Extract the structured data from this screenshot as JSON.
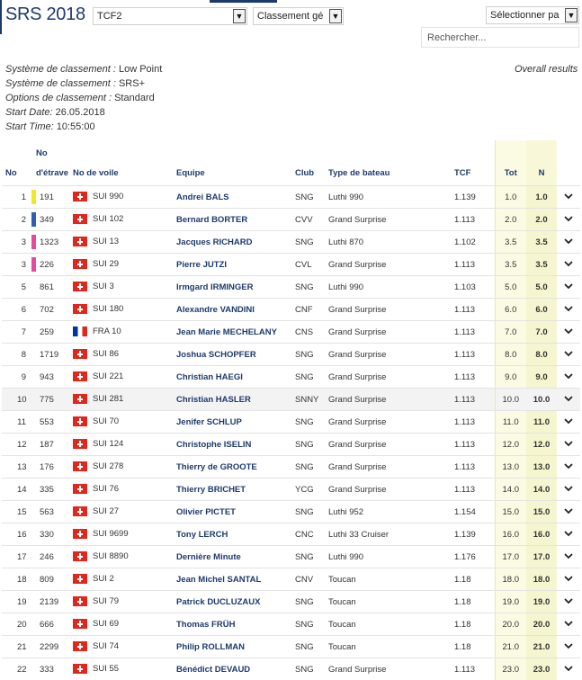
{
  "header": {
    "title": "SRS 2018",
    "race_select": "TCF2",
    "ranking_select": "Classement gé",
    "choose_select": "Sélectionner pa",
    "search_placeholder": "Rechercher...",
    "overall_link": "Overall results"
  },
  "info": [
    {
      "key": "Système de classement :",
      "value": "Low Point"
    },
    {
      "key": "Système de classement :",
      "value": "SRS+"
    },
    {
      "key": "Options de classement :",
      "value": "Standard"
    },
    {
      "key": "Start Date:",
      "value": "26.05.2018"
    },
    {
      "key": "Start Time:",
      "value": "10:55:00"
    }
  ],
  "columns": {
    "no": "No",
    "bow_top": "No",
    "bow_bottom": "d'étrave",
    "sail": "No de voile",
    "crew": "Equipe",
    "club": "Club",
    "boat": "Type de bateau",
    "tcf": "TCF",
    "tot": "Tot",
    "n": "N"
  },
  "colors": {
    "accent": "#1d3a6e",
    "yellow": "#f2e82a",
    "blue": "#2f5fb5",
    "pink": "#e84a9b"
  },
  "rows": [
    {
      "no": "1",
      "marker": "yellow",
      "bow": "191",
      "flag": "sui",
      "sail": "SUI 990",
      "crew": "Andrei BALS",
      "club": "SNG",
      "boat": "Luthi 990",
      "tcf": "1.139",
      "tot": "1.0",
      "n": "1.0"
    },
    {
      "no": "2",
      "marker": "blue",
      "bow": "349",
      "flag": "sui",
      "sail": "SUI 102",
      "crew": "Bernard BORTER",
      "club": "CVV",
      "boat": "Grand Surprise",
      "tcf": "1.113",
      "tot": "2.0",
      "n": "2.0"
    },
    {
      "no": "3",
      "marker": "pink",
      "bow": "1323",
      "flag": "sui",
      "sail": "SUI 13",
      "crew": "Jacques RICHARD",
      "club": "SNG",
      "boat": "Luthi 870",
      "tcf": "1.102",
      "tot": "3.5",
      "n": "3.5"
    },
    {
      "no": "3",
      "marker": "pink",
      "bow": "226",
      "flag": "sui",
      "sail": "SUI 29",
      "crew": "Pierre JUTZI",
      "club": "CVL",
      "boat": "Grand Surprise",
      "tcf": "1.113",
      "tot": "3.5",
      "n": "3.5"
    },
    {
      "no": "5",
      "marker": "",
      "bow": "861",
      "flag": "sui",
      "sail": "SUI 3",
      "crew": "Irmgard IRMINGER",
      "club": "SNG",
      "boat": "Luthi 990",
      "tcf": "1.103",
      "tot": "5.0",
      "n": "5.0"
    },
    {
      "no": "6",
      "marker": "",
      "bow": "702",
      "flag": "sui",
      "sail": "SUI 180",
      "crew": "Alexandre VANDINI",
      "club": "CNF",
      "boat": "Grand Surprise",
      "tcf": "1.113",
      "tot": "6.0",
      "n": "6.0"
    },
    {
      "no": "7",
      "marker": "",
      "bow": "259",
      "flag": "fra",
      "sail": "FRA 10",
      "crew": "Jean Marie MECHELANY",
      "club": "CNS",
      "boat": "Grand Surprise",
      "tcf": "1.113",
      "tot": "7.0",
      "n": "7.0"
    },
    {
      "no": "8",
      "marker": "",
      "bow": "1719",
      "flag": "sui",
      "sail": "SUI 86",
      "crew": "Joshua SCHOPFER",
      "club": "SNG",
      "boat": "Grand Surprise",
      "tcf": "1.113",
      "tot": "8.0",
      "n": "8.0"
    },
    {
      "no": "9",
      "marker": "",
      "bow": "943",
      "flag": "sui",
      "sail": "SUI 221",
      "crew": "Christian HAEGI",
      "club": "SNG",
      "boat": "Grand Surprise",
      "tcf": "1.113",
      "tot": "9.0",
      "n": "9.0"
    },
    {
      "no": "10",
      "marker": "",
      "bow": "775",
      "flag": "sui",
      "sail": "SUI 281",
      "crew": "Christian HASLER",
      "club": "SNNY",
      "boat": "Grand Surprise",
      "tcf": "1.113",
      "tot": "10.0",
      "n": "10.0",
      "highlight": true
    },
    {
      "no": "11",
      "marker": "",
      "bow": "553",
      "flag": "sui",
      "sail": "SUI 70",
      "crew": "Jenifer SCHLUP",
      "club": "SNG",
      "boat": "Grand Surprise",
      "tcf": "1.113",
      "tot": "11.0",
      "n": "11.0"
    },
    {
      "no": "12",
      "marker": "",
      "bow": "187",
      "flag": "sui",
      "sail": "SUI 124",
      "crew": "Christophe ISELIN",
      "club": "SNG",
      "boat": "Grand Surprise",
      "tcf": "1.113",
      "tot": "12.0",
      "n": "12.0"
    },
    {
      "no": "13",
      "marker": "",
      "bow": "176",
      "flag": "sui",
      "sail": "SUI 278",
      "crew": "Thierry de GROOTE",
      "club": "SNG",
      "boat": "Grand Surprise",
      "tcf": "1.113",
      "tot": "13.0",
      "n": "13.0"
    },
    {
      "no": "14",
      "marker": "",
      "bow": "335",
      "flag": "sui",
      "sail": "SUI 76",
      "crew": "Thierry BRICHET",
      "club": "YCG",
      "boat": "Grand Surprise",
      "tcf": "1.113",
      "tot": "14.0",
      "n": "14.0"
    },
    {
      "no": "15",
      "marker": "",
      "bow": "563",
      "flag": "sui",
      "sail": "SUI 27",
      "crew": "Olivier PICTET",
      "club": "SNG",
      "boat": "Luthi 952",
      "tcf": "1.154",
      "tot": "15.0",
      "n": "15.0"
    },
    {
      "no": "16",
      "marker": "",
      "bow": "330",
      "flag": "sui",
      "sail": "SUI 9699",
      "crew": "Tony LERCH",
      "club": "CNC",
      "boat": "Luthi 33 Cruiser",
      "tcf": "1.139",
      "tot": "16.0",
      "n": "16.0"
    },
    {
      "no": "17",
      "marker": "",
      "bow": "246",
      "flag": "sui",
      "sail": "SUI 8890",
      "crew": "Dernière Minute",
      "club": "SNG",
      "boat": "Luthi 990",
      "tcf": "1.176",
      "tot": "17.0",
      "n": "17.0"
    },
    {
      "no": "18",
      "marker": "",
      "bow": "809",
      "flag": "sui",
      "sail": "SUI 2",
      "crew": "Jean Michel SANTAL",
      "club": "CNV",
      "boat": "Toucan",
      "tcf": "1.18",
      "tot": "18.0",
      "n": "18.0"
    },
    {
      "no": "19",
      "marker": "",
      "bow": "2139",
      "flag": "sui",
      "sail": "SUI 79",
      "crew": "Patrick DUCLUZAUX",
      "club": "SNG",
      "boat": "Toucan",
      "tcf": "1.18",
      "tot": "19.0",
      "n": "19.0"
    },
    {
      "no": "20",
      "marker": "",
      "bow": "666",
      "flag": "sui",
      "sail": "SUI 69",
      "crew": "Thomas FRÜH",
      "club": "SNG",
      "boat": "Toucan",
      "tcf": "1.18",
      "tot": "20.0",
      "n": "20.0"
    },
    {
      "no": "21",
      "marker": "",
      "bow": "2299",
      "flag": "sui",
      "sail": "SUI 74",
      "crew": "Philip ROLLMAN",
      "club": "SNG",
      "boat": "Toucan",
      "tcf": "1.18",
      "tot": "21.0",
      "n": "21.0"
    },
    {
      "no": "22",
      "marker": "",
      "bow": "333",
      "flag": "sui",
      "sail": "SUI 55",
      "crew": "Bénédict DEVAUD",
      "club": "SNG",
      "boat": "Grand Surprise",
      "tcf": "1.113",
      "tot": "23.0",
      "n": "23.0"
    }
  ]
}
